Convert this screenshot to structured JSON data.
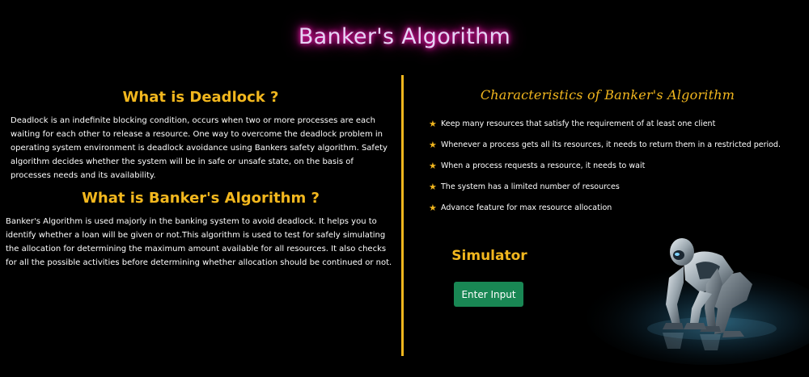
{
  "title": "Banker's Algorithm",
  "deadlock": {
    "heading": "What is Deadlock ?",
    "text": "Deadlock is an indefinite blocking condition, occurs when two or more processes are each waiting for each other to release a resource. One way to overcome the deadlock problem in operating system environment is deadlock avoidance using Bankers safety algorithm. Safety algorithm decides whether the system will be in safe or unsafe state, on the basis of processes needs and its availability."
  },
  "banker": {
    "heading": "What is Banker's Algorithm ?",
    "text": "Banker's Algorithm is used majorly in the banking system to avoid deadlock. It helps you to identify whether a loan will be given or not.This algorithm is used to test for safely simulating the allocation for determining the maximum amount available for all resources. It also checks for all the possible activities before determining whether allocation should be continued or not."
  },
  "characteristics": {
    "heading": "Characteristics of Banker's Algorithm",
    "bullet_icon": "star-icon",
    "items": [
      "Keep many resources that satisfy the requirement of at least one client",
      "Whenever a process gets all its resources, it needs to return them in a restricted period.",
      "When a process requests a resource, it needs to wait",
      "The system has a limited number of resources",
      "Advance feature for max resource allocation"
    ]
  },
  "simulator": {
    "heading": "Simulator",
    "button_label": "Enter Input"
  },
  "colors": {
    "accent": "#f2b71e",
    "button": "#198754",
    "title_glow": "#ff1ab3",
    "background": "#000000"
  }
}
